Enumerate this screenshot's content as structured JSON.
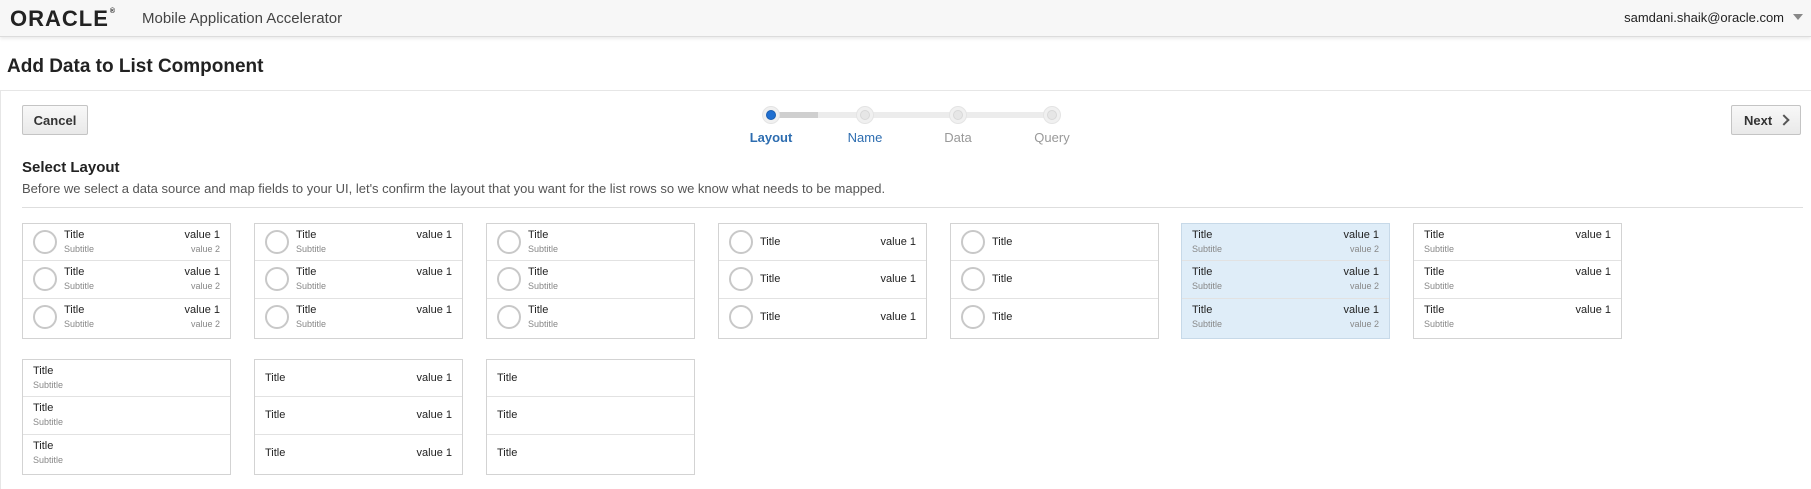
{
  "header": {
    "logo": "ORACLE",
    "logo_mark": "®",
    "app_title": "Mobile Application Accelerator",
    "user": "samdani.shaik@oracle.com",
    "user_menu_icon": "caret-down-icon"
  },
  "page": {
    "title": "Add Data to List Component"
  },
  "toolbar": {
    "cancel_label": "Cancel",
    "next_label": "Next",
    "next_icon": "chevron-right-icon"
  },
  "steps": [
    {
      "label": "Layout",
      "state": "active"
    },
    {
      "label": "Name",
      "state": "next"
    },
    {
      "label": "Data",
      "state": "pending"
    },
    {
      "label": "Query",
      "state": "pending"
    }
  ],
  "section": {
    "title": "Select Layout",
    "description": "Before we select a data source and map fields to your UI, let's confirm the layout that you want for the list rows so we know what needs to be mapped."
  },
  "colors": {
    "accent": "#1f6fd1",
    "selected_bg": "#dfedf8",
    "step_text": "#2d6db0"
  },
  "layouts": [
    {
      "rows": [
        {
          "title": "Title",
          "subtitle": "Subtitle",
          "value1": "value 1",
          "value2": "value 2"
        },
        {
          "title": "Title",
          "subtitle": "Subtitle",
          "value1": "value 1",
          "value2": "value 2"
        },
        {
          "title": "Title",
          "subtitle": "Subtitle",
          "value1": "value 1",
          "value2": "value 2"
        }
      ]
    },
    {
      "rows": [
        {
          "title": "Title",
          "subtitle": "Subtitle",
          "value1": "value 1"
        },
        {
          "title": "Title",
          "subtitle": "Subtitle",
          "value1": "value 1"
        },
        {
          "title": "Title",
          "subtitle": "Subtitle",
          "value1": "value 1"
        }
      ]
    },
    {
      "rows": [
        {
          "title": "Title",
          "subtitle": "Subtitle"
        },
        {
          "title": "Title",
          "subtitle": "Subtitle"
        },
        {
          "title": "Title",
          "subtitle": "Subtitle"
        }
      ]
    },
    {
      "rows": [
        {
          "title": "Title",
          "value1": "value 1"
        },
        {
          "title": "Title",
          "value1": "value 1"
        },
        {
          "title": "Title",
          "value1": "value 1"
        }
      ]
    },
    {
      "rows": [
        {
          "title": "Title"
        },
        {
          "title": "Title"
        },
        {
          "title": "Title"
        }
      ]
    },
    {
      "selected": true,
      "rows": [
        {
          "title": "Title",
          "subtitle": "Subtitle",
          "value1": "value 1",
          "value2": "value 2"
        },
        {
          "title": "Title",
          "subtitle": "Subtitle",
          "value1": "value 1",
          "value2": "value 2"
        },
        {
          "title": "Title",
          "subtitle": "Subtitle",
          "value1": "value 1",
          "value2": "value 2"
        }
      ]
    },
    {
      "rows": [
        {
          "title": "Title",
          "subtitle": "Subtitle",
          "value1": "value 1"
        },
        {
          "title": "Title",
          "subtitle": "Subtitle",
          "value1": "value 1"
        },
        {
          "title": "Title",
          "subtitle": "Subtitle",
          "value1": "value 1"
        }
      ]
    },
    {
      "rows": [
        {
          "title": "Title",
          "subtitle": "Subtitle"
        },
        {
          "title": "Title",
          "subtitle": "Subtitle"
        },
        {
          "title": "Title",
          "subtitle": "Subtitle"
        }
      ]
    },
    {
      "rows": [
        {
          "title": "Title",
          "value1": "value 1"
        },
        {
          "title": "Title",
          "value1": "value 1"
        },
        {
          "title": "Title",
          "value1": "value 1"
        }
      ]
    },
    {
      "rows": [
        {
          "title": "Title"
        },
        {
          "title": "Title"
        },
        {
          "title": "Title"
        }
      ]
    }
  ]
}
